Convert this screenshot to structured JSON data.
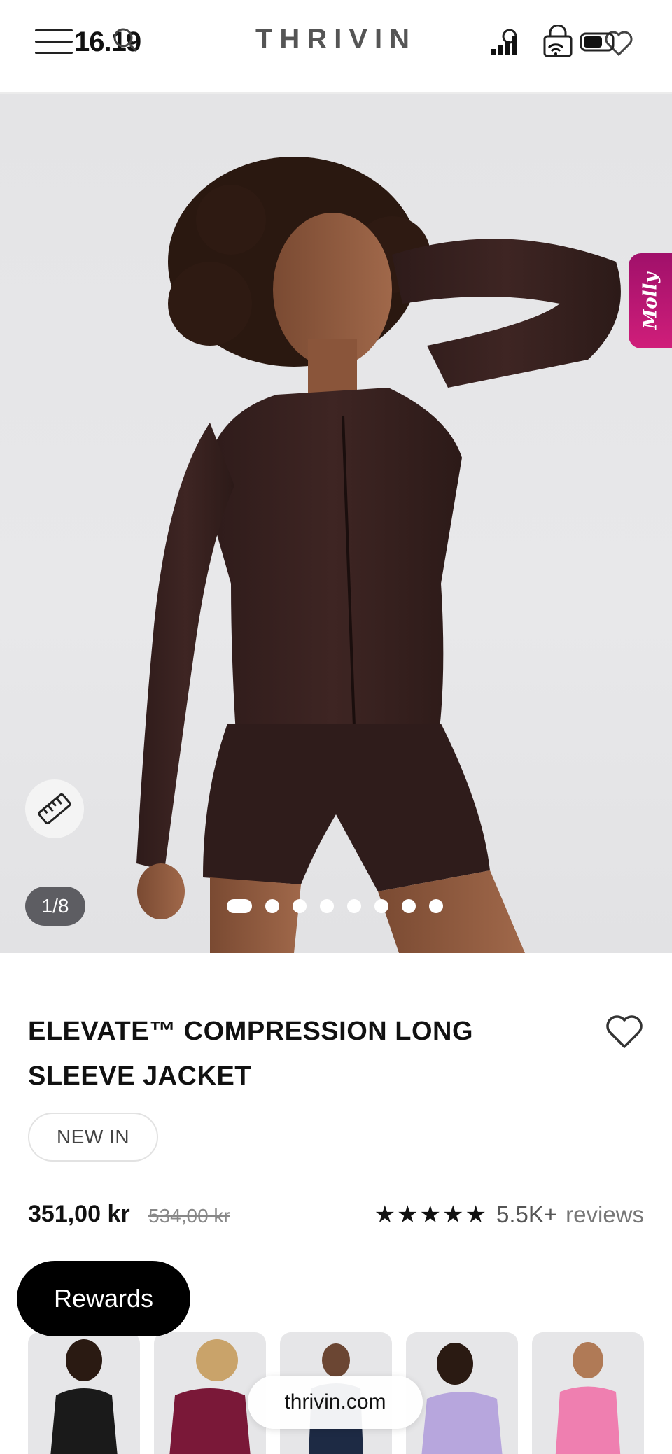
{
  "status_bar": {
    "time": "16.19"
  },
  "header": {
    "logo": "THRIVIN"
  },
  "hero": {
    "chat_tab_label": "Molly",
    "image_counter": "1/8",
    "slide_count": 8,
    "active_slide": 1
  },
  "product": {
    "title": "ELEVATE™ COMPRESSION LONG SLEEVE JACKET",
    "badge": "NEW IN",
    "price": "351,00 kr",
    "original_price": "534,00 kr",
    "rating_stars": "★★★★★",
    "review_count": "5.5K+",
    "review_label": "reviews"
  },
  "rewards": {
    "label": "Rewards"
  },
  "swatches": [
    {
      "color": "#1a1a1a"
    },
    {
      "color": "#7a1838"
    },
    {
      "color": "#1d2a44"
    },
    {
      "color": "#b7a6dd"
    },
    {
      "color": "#ef7fb0"
    }
  ],
  "browser": {
    "url": "thrivin.com"
  },
  "colors": {
    "garment": "#3a2220",
    "chat_tab": "#c01a74",
    "hero_bg": "#e6e6e8"
  }
}
